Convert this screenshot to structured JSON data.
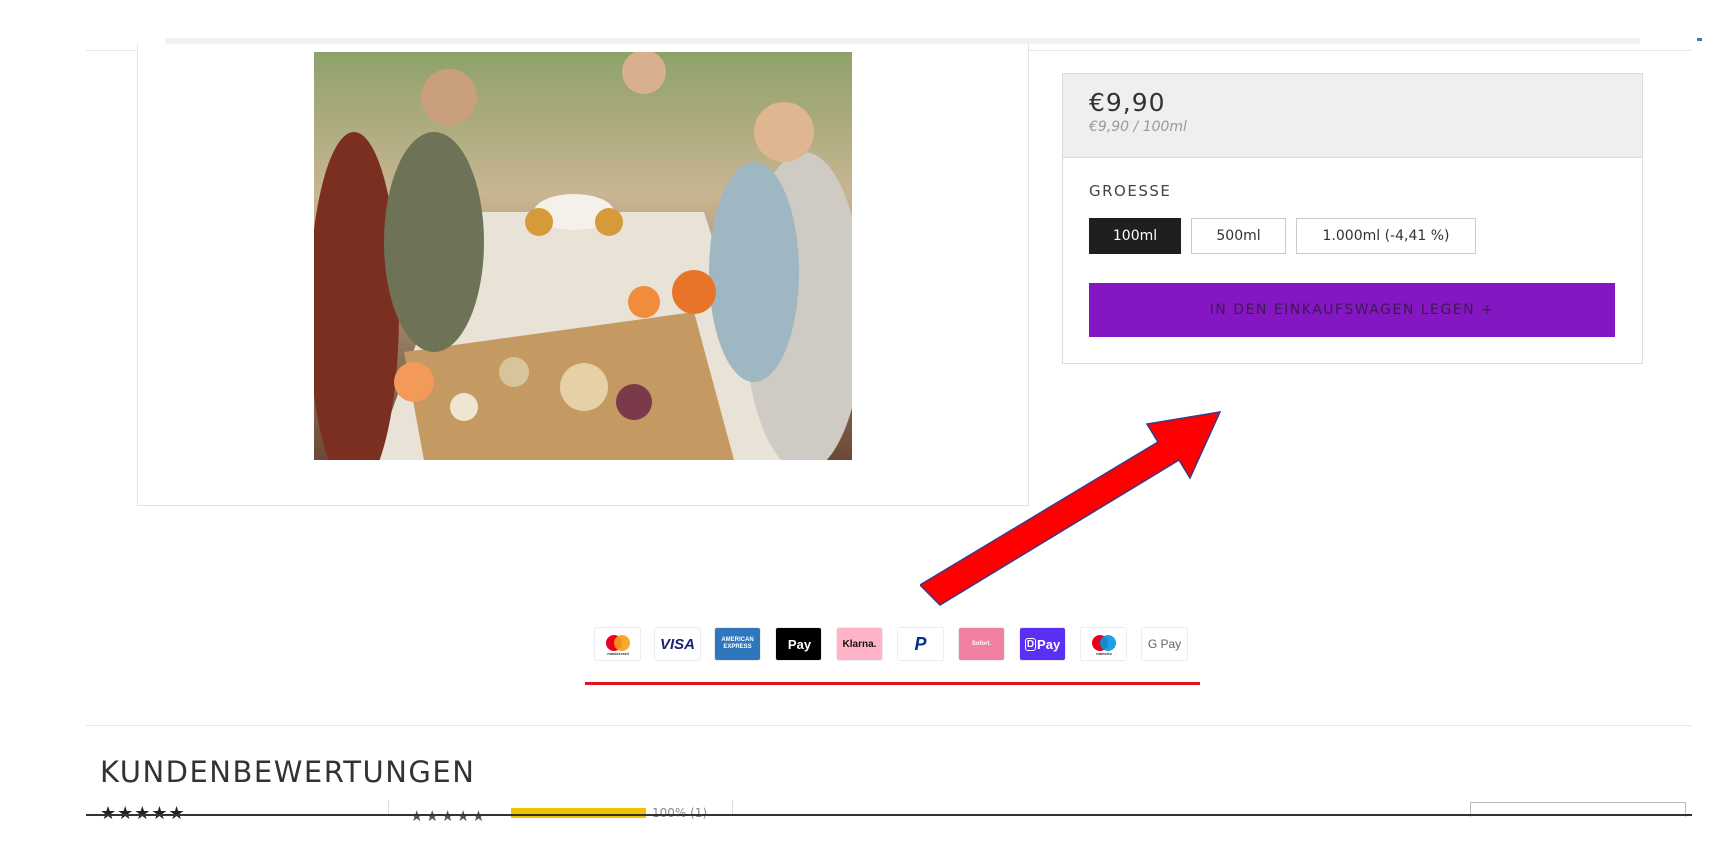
{
  "product": {
    "price": "€9,90",
    "unit_price": "€9,90 / 100ml",
    "size_label": "GROESSE",
    "sizes": [
      "100ml",
      "500ml",
      "1.000ml (-4,41 %)"
    ],
    "selected_size": "100ml",
    "add_to_cart_label": "IN DEN EINKAUFSWAGEN LEGEN  +"
  },
  "payment_methods": [
    {
      "name": "mastercard",
      "label": "mastercard"
    },
    {
      "name": "visa",
      "label": "VISA"
    },
    {
      "name": "amex",
      "label": "AMERICAN EXPRESS"
    },
    {
      "name": "apple-pay",
      "label": "Pay"
    },
    {
      "name": "klarna",
      "label": "Klarna."
    },
    {
      "name": "paypal",
      "label": "P"
    },
    {
      "name": "sofort",
      "label": "Sofort."
    },
    {
      "name": "shop-pay",
      "label": "Pay"
    },
    {
      "name": "maestro",
      "label": "maestro"
    },
    {
      "name": "google-pay",
      "label": "G Pay"
    }
  ],
  "reviews": {
    "title": "KUNDENBEWERTUNGEN",
    "summary_stars": "★★★★★",
    "row_stars": "★★★★★",
    "row_percent": "100% (1)"
  },
  "colors": {
    "accent_purple": "#8417c2",
    "annotation_red": "#ff0000",
    "rating_yellow": "#f2c200"
  }
}
